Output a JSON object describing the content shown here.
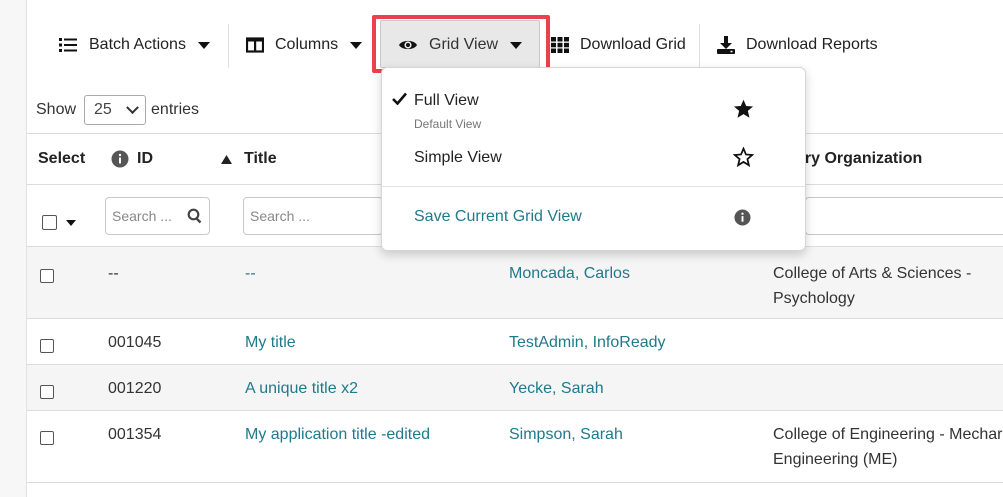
{
  "toolbar": {
    "batch_actions_label": "Batch Actions",
    "columns_label": "Columns",
    "grid_view_label": "Grid View",
    "download_grid_label": "Download Grid",
    "download_reports_label": "Download Reports"
  },
  "entries": {
    "show_label": "Show",
    "page_size": "25",
    "entries_label": "entries"
  },
  "table": {
    "headers": {
      "select": "Select",
      "id": "ID",
      "title": "Title",
      "primary_org": "ary Organization"
    },
    "filters": {
      "id_placeholder": "Search ...",
      "title_placeholder": "Search ..."
    },
    "rows": [
      {
        "id": "--",
        "title": "--",
        "person": "Moncada, Carlos",
        "org_line1": "College of Arts & Sciences -",
        "org_line2": "Psychology"
      },
      {
        "id": "001045",
        "title": "My title",
        "person": "TestAdmin, InfoReady",
        "org_line1": "",
        "org_line2": ""
      },
      {
        "id": "001220",
        "title": "A unique title x2",
        "person": "Yecke, Sarah",
        "org_line1": "",
        "org_line2": ""
      },
      {
        "id": "001354",
        "title": "My application title -edited",
        "person": "Simpson, Sarah",
        "org_line1": "College of Engineering - Mechar",
        "org_line2": "Engineering (ME)"
      }
    ]
  },
  "grid_view_menu": {
    "full_view_label": "Full View",
    "full_view_sub": "Default View",
    "simple_view_label": "Simple View",
    "save_label": "Save Current Grid View"
  },
  "colors": {
    "link": "#1e7a8c",
    "highlight": "#e8434b",
    "icon_dark": "#111111",
    "info_icon": "#555555"
  },
  "icons": {
    "batch_actions": "list-icon",
    "columns": "columns-icon",
    "grid_view": "eye-icon",
    "download_grid": "grid-icon",
    "download_reports": "download-icon",
    "full_view_check": "check-icon",
    "full_view_star": "star-filled-icon",
    "simple_view_star": "star-outline-icon",
    "save_info": "info-icon",
    "id_info": "info-icon",
    "search": "search-icon",
    "sort": "sort-asc-icon"
  }
}
